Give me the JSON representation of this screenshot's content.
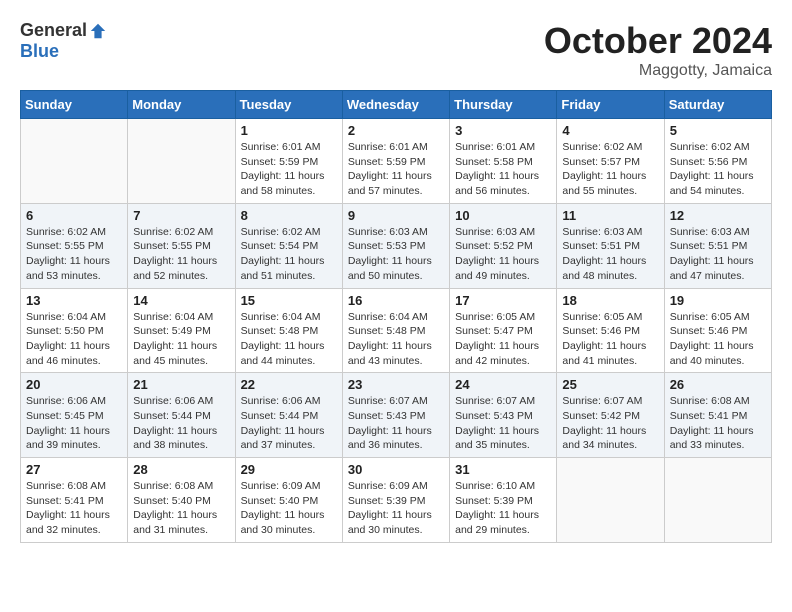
{
  "header": {
    "logo_general": "General",
    "logo_blue": "Blue",
    "month": "October 2024",
    "location": "Maggotty, Jamaica"
  },
  "days_of_week": [
    "Sunday",
    "Monday",
    "Tuesday",
    "Wednesday",
    "Thursday",
    "Friday",
    "Saturday"
  ],
  "weeks": [
    [
      {
        "day": "",
        "content": ""
      },
      {
        "day": "",
        "content": ""
      },
      {
        "day": "1",
        "content": "Sunrise: 6:01 AM\nSunset: 5:59 PM\nDaylight: 11 hours and 58 minutes."
      },
      {
        "day": "2",
        "content": "Sunrise: 6:01 AM\nSunset: 5:59 PM\nDaylight: 11 hours and 57 minutes."
      },
      {
        "day": "3",
        "content": "Sunrise: 6:01 AM\nSunset: 5:58 PM\nDaylight: 11 hours and 56 minutes."
      },
      {
        "day": "4",
        "content": "Sunrise: 6:02 AM\nSunset: 5:57 PM\nDaylight: 11 hours and 55 minutes."
      },
      {
        "day": "5",
        "content": "Sunrise: 6:02 AM\nSunset: 5:56 PM\nDaylight: 11 hours and 54 minutes."
      }
    ],
    [
      {
        "day": "6",
        "content": "Sunrise: 6:02 AM\nSunset: 5:55 PM\nDaylight: 11 hours and 53 minutes."
      },
      {
        "day": "7",
        "content": "Sunrise: 6:02 AM\nSunset: 5:55 PM\nDaylight: 11 hours and 52 minutes."
      },
      {
        "day": "8",
        "content": "Sunrise: 6:02 AM\nSunset: 5:54 PM\nDaylight: 11 hours and 51 minutes."
      },
      {
        "day": "9",
        "content": "Sunrise: 6:03 AM\nSunset: 5:53 PM\nDaylight: 11 hours and 50 minutes."
      },
      {
        "day": "10",
        "content": "Sunrise: 6:03 AM\nSunset: 5:52 PM\nDaylight: 11 hours and 49 minutes."
      },
      {
        "day": "11",
        "content": "Sunrise: 6:03 AM\nSunset: 5:51 PM\nDaylight: 11 hours and 48 minutes."
      },
      {
        "day": "12",
        "content": "Sunrise: 6:03 AM\nSunset: 5:51 PM\nDaylight: 11 hours and 47 minutes."
      }
    ],
    [
      {
        "day": "13",
        "content": "Sunrise: 6:04 AM\nSunset: 5:50 PM\nDaylight: 11 hours and 46 minutes."
      },
      {
        "day": "14",
        "content": "Sunrise: 6:04 AM\nSunset: 5:49 PM\nDaylight: 11 hours and 45 minutes."
      },
      {
        "day": "15",
        "content": "Sunrise: 6:04 AM\nSunset: 5:48 PM\nDaylight: 11 hours and 44 minutes."
      },
      {
        "day": "16",
        "content": "Sunrise: 6:04 AM\nSunset: 5:48 PM\nDaylight: 11 hours and 43 minutes."
      },
      {
        "day": "17",
        "content": "Sunrise: 6:05 AM\nSunset: 5:47 PM\nDaylight: 11 hours and 42 minutes."
      },
      {
        "day": "18",
        "content": "Sunrise: 6:05 AM\nSunset: 5:46 PM\nDaylight: 11 hours and 41 minutes."
      },
      {
        "day": "19",
        "content": "Sunrise: 6:05 AM\nSunset: 5:46 PM\nDaylight: 11 hours and 40 minutes."
      }
    ],
    [
      {
        "day": "20",
        "content": "Sunrise: 6:06 AM\nSunset: 5:45 PM\nDaylight: 11 hours and 39 minutes."
      },
      {
        "day": "21",
        "content": "Sunrise: 6:06 AM\nSunset: 5:44 PM\nDaylight: 11 hours and 38 minutes."
      },
      {
        "day": "22",
        "content": "Sunrise: 6:06 AM\nSunset: 5:44 PM\nDaylight: 11 hours and 37 minutes."
      },
      {
        "day": "23",
        "content": "Sunrise: 6:07 AM\nSunset: 5:43 PM\nDaylight: 11 hours and 36 minutes."
      },
      {
        "day": "24",
        "content": "Sunrise: 6:07 AM\nSunset: 5:43 PM\nDaylight: 11 hours and 35 minutes."
      },
      {
        "day": "25",
        "content": "Sunrise: 6:07 AM\nSunset: 5:42 PM\nDaylight: 11 hours and 34 minutes."
      },
      {
        "day": "26",
        "content": "Sunrise: 6:08 AM\nSunset: 5:41 PM\nDaylight: 11 hours and 33 minutes."
      }
    ],
    [
      {
        "day": "27",
        "content": "Sunrise: 6:08 AM\nSunset: 5:41 PM\nDaylight: 11 hours and 32 minutes."
      },
      {
        "day": "28",
        "content": "Sunrise: 6:08 AM\nSunset: 5:40 PM\nDaylight: 11 hours and 31 minutes."
      },
      {
        "day": "29",
        "content": "Sunrise: 6:09 AM\nSunset: 5:40 PM\nDaylight: 11 hours and 30 minutes."
      },
      {
        "day": "30",
        "content": "Sunrise: 6:09 AM\nSunset: 5:39 PM\nDaylight: 11 hours and 30 minutes."
      },
      {
        "day": "31",
        "content": "Sunrise: 6:10 AM\nSunset: 5:39 PM\nDaylight: 11 hours and 29 minutes."
      },
      {
        "day": "",
        "content": ""
      },
      {
        "day": "",
        "content": ""
      }
    ]
  ]
}
